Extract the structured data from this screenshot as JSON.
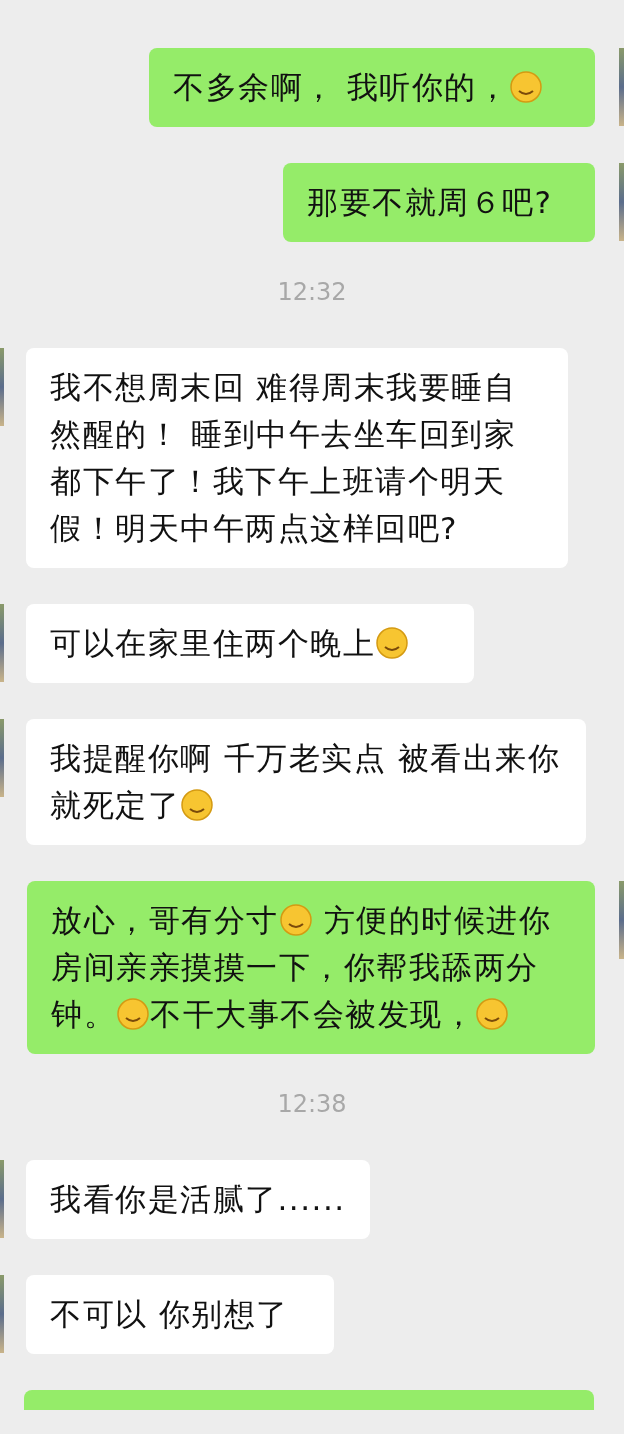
{
  "messages": [
    {
      "kind": "message",
      "outgoing": true,
      "parts": [
        {
          "kind": "text",
          "text": "不多余啊， 我听你的，"
        },
        {
          "kind": "emoji"
        }
      ]
    },
    {
      "kind": "message",
      "outgoing": true,
      "parts": [
        {
          "kind": "text",
          "text": "那要不就周６吧?"
        }
      ]
    },
    {
      "kind": "time",
      "text": "12:32"
    },
    {
      "kind": "message",
      "outgoing": false,
      "parts": [
        {
          "kind": "text",
          "text": "我不想周末回 难得周末我要睡自然醒的！ 睡到中午去坐车回到家都下午了！我下午上班请个明天假！明天中午两点这样回吧?"
        }
      ]
    },
    {
      "kind": "message",
      "outgoing": false,
      "parts": [
        {
          "kind": "text",
          "text": "可以在家里住两个晚上"
        },
        {
          "kind": "emoji"
        }
      ]
    },
    {
      "kind": "message",
      "outgoing": false,
      "parts": [
        {
          "kind": "text",
          "text": "我提醒你啊  千万老实点 被看出来你就死定了"
        },
        {
          "kind": "emoji"
        }
      ]
    },
    {
      "kind": "message",
      "outgoing": true,
      "parts": [
        {
          "kind": "text",
          "text": "放心，哥有分寸"
        },
        {
          "kind": "emoji"
        },
        {
          "kind": "text",
          "text": " 方便的时候进你房间亲亲摸摸一下，你帮我舔两分钟。"
        },
        {
          "kind": "emoji"
        },
        {
          "kind": "text",
          "text": "不干大事不会被发现，"
        },
        {
          "kind": "emoji"
        }
      ]
    },
    {
      "kind": "time",
      "text": "12:38"
    },
    {
      "kind": "message",
      "outgoing": false,
      "parts": [
        {
          "kind": "text",
          "text": "我看你是活腻了......"
        }
      ]
    },
    {
      "kind": "message",
      "outgoing": false,
      "parts": [
        {
          "kind": "text",
          "text": "不可以 你别想了"
        }
      ]
    },
    {
      "kind": "cut",
      "outgoing": true
    }
  ]
}
